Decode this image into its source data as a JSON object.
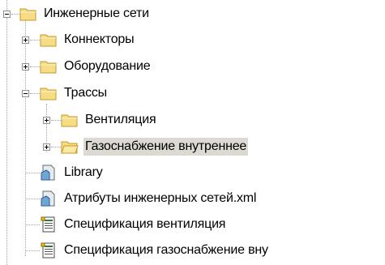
{
  "tree": {
    "nodes": [
      {
        "label": "Инженерные сети",
        "icon": "folder-icon",
        "expander": "minus"
      },
      {
        "label": "Коннекторы",
        "icon": "folder-icon",
        "expander": "plus"
      },
      {
        "label": "Оборудование",
        "icon": "folder-icon",
        "expander": "plus"
      },
      {
        "label": "Трассы",
        "icon": "folder-icon",
        "expander": "minus"
      },
      {
        "label": "Вентиляция",
        "icon": "folder-icon",
        "expander": "plus"
      },
      {
        "label": "Газоснабжение внутреннее",
        "icon": "folder-icon",
        "expander": "plus",
        "selected": true
      },
      {
        "label": "Library",
        "icon": "library-document-icon"
      },
      {
        "label": "Атрибуты инженерных сетей.xml",
        "icon": "library-document-icon"
      },
      {
        "label": "Спецификация вентиляция",
        "icon": "specification-icon"
      },
      {
        "label": "Спецификация газоснабжение вну",
        "icon": "specification-icon"
      }
    ]
  },
  "colors": {
    "folder_fill": "#f6dc84",
    "folder_border": "#c49a2c",
    "selection": "#dcd8d2",
    "tree_lines": "#a0a0a0"
  }
}
